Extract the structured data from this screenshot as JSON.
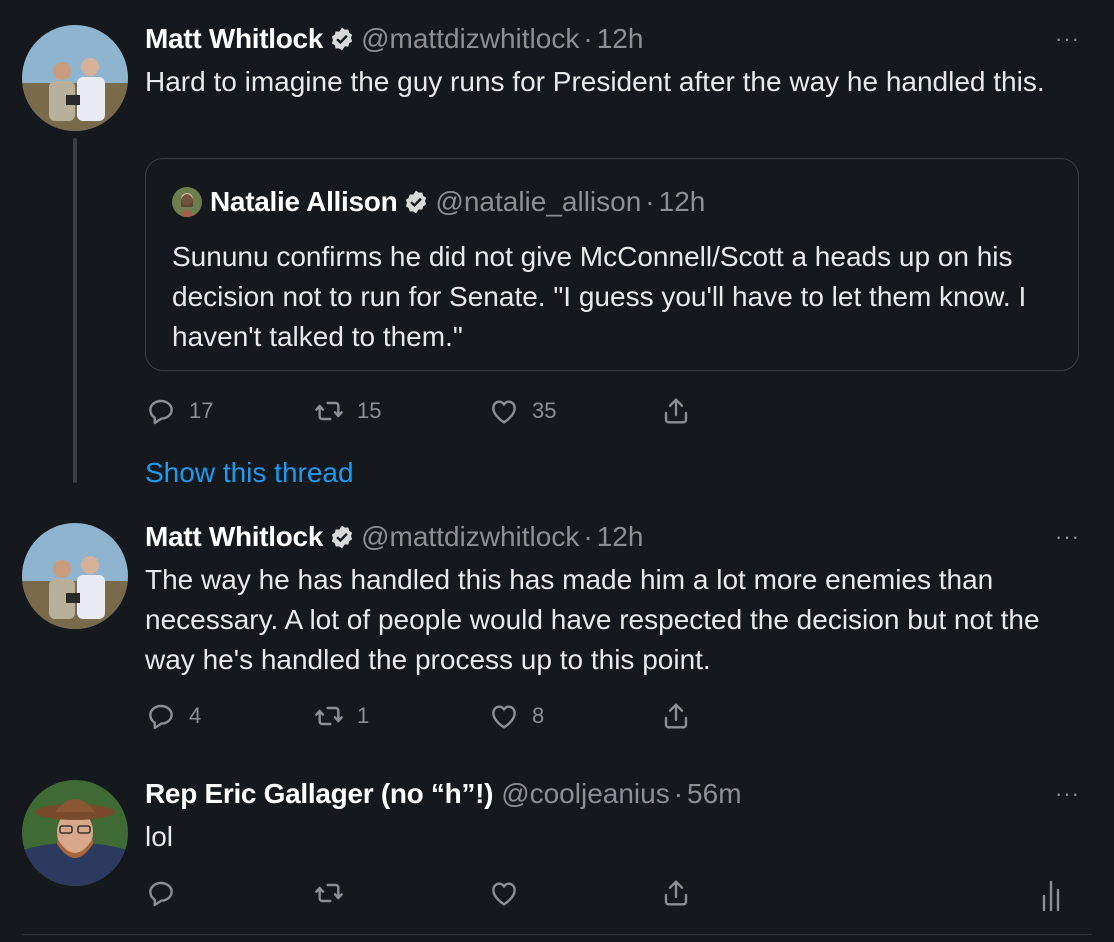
{
  "tweets": [
    {
      "name": "Matt Whitlock",
      "handle": "@mattdizwhitlock",
      "dot": "·",
      "time": "12h",
      "text": "Hard to imagine the guy runs for President after the way he handled this.",
      "more": "···",
      "quote": {
        "name": "Natalie Allison",
        "handle": "@natalie_allison",
        "dot": "·",
        "time": "12h",
        "text": "Sununu confirms he did not give McConnell/Scott a heads up on his decision not to run for Senate. \"I guess you'll have to let them know. I haven't talked to them.\""
      },
      "replies": "17",
      "retweets": "15",
      "likes": "35"
    },
    {
      "name": "Matt Whitlock",
      "handle": "@mattdizwhitlock",
      "dot": "·",
      "time": "12h",
      "text": "The way he has handled this has made him a lot more enemies than necessary. A lot of people would have respected the decision but not the way he's handled the process up to this point.",
      "more": "···",
      "replies": "4",
      "retweets": "1",
      "likes": "8"
    },
    {
      "name": "Rep Eric Gallager (no “h”!)",
      "handle": "@cooljeanius",
      "dot": "·",
      "time": "56m",
      "text": "lol",
      "more": "···"
    }
  ],
  "show_thread": "Show this thread",
  "colors": {
    "background": "#15181c",
    "link": "#1d9bf0",
    "muted": "#8b9096",
    "verified": "#d9d9d9"
  },
  "icons": [
    "reply-icon",
    "retweet-icon",
    "like-icon",
    "share-icon",
    "verified-icon",
    "more-icon",
    "analytics-icon"
  ]
}
